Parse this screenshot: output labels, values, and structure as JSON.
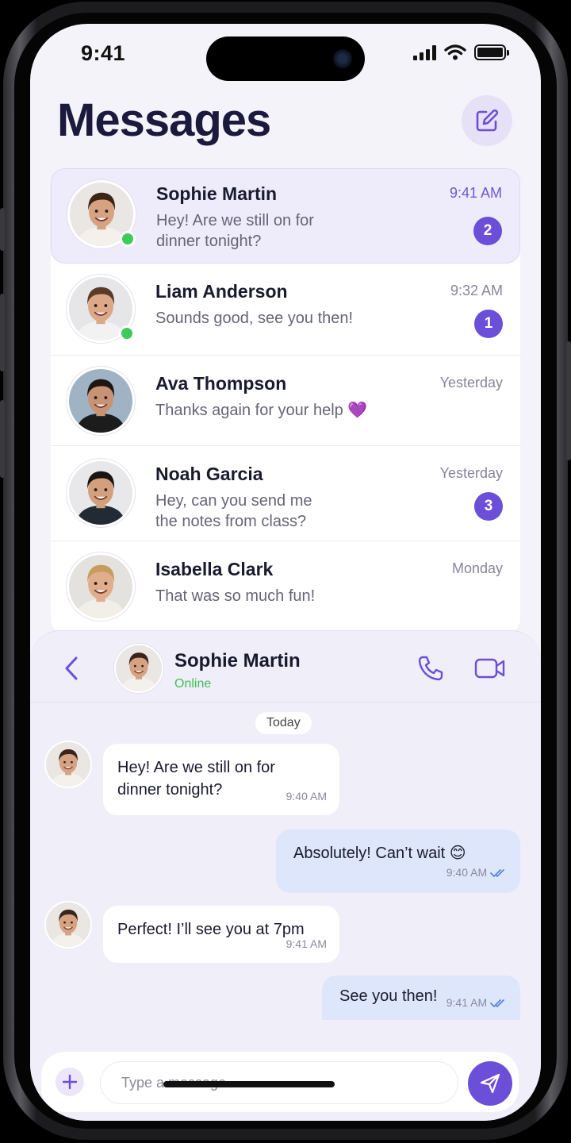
{
  "status_bar": {
    "time": "9:41"
  },
  "header": {
    "title": "Messages",
    "compose_icon": "compose-icon"
  },
  "conversations": [
    {
      "name": "Sophie Martin",
      "preview": "Hey! Are we still on for dinner tonight?",
      "time": "9:41 AM",
      "unread": "2",
      "online": true,
      "active": true
    },
    {
      "name": "Liam Anderson",
      "preview": "Sounds good, see you then!",
      "time": "9:32 AM",
      "unread": "1",
      "online": true,
      "active": false
    },
    {
      "name": "Ava Thompson",
      "preview": "Thanks again for your help 💜",
      "time": "Yesterday",
      "unread": "",
      "online": false,
      "active": false
    },
    {
      "name": "Noah Garcia",
      "preview": "Hey, can you send me the notes from class?",
      "time": "Yesterday",
      "unread": "3",
      "online": false,
      "active": false
    },
    {
      "name": "Isabella Clark",
      "preview": "That was so much fun!",
      "time": "Monday",
      "unread": "",
      "online": false,
      "active": false
    }
  ],
  "chat": {
    "contact_name": "Sophie Martin",
    "contact_status": "Online",
    "day_label": "Today",
    "messages": [
      {
        "direction": "in",
        "text": "Hey! Are we still on for dinner tonight?",
        "time": "9:40 AM"
      },
      {
        "direction": "out",
        "text": "Absolutely! Can’t wait 😊",
        "time": "9:40 AM",
        "read": true
      },
      {
        "direction": "in",
        "text": "Perfect! I’ll see you at 7pm",
        "time": "9:41 AM"
      },
      {
        "direction": "out",
        "text": "See you then!",
        "time": "9:41 AM",
        "read": true
      }
    ]
  },
  "composer": {
    "placeholder": "Type a message..."
  },
  "colors": {
    "accent": "#6b4fd8",
    "online": "#3ecb5a",
    "outgoing_bubble": "#dde6fb",
    "title": "#1b1a3d"
  }
}
